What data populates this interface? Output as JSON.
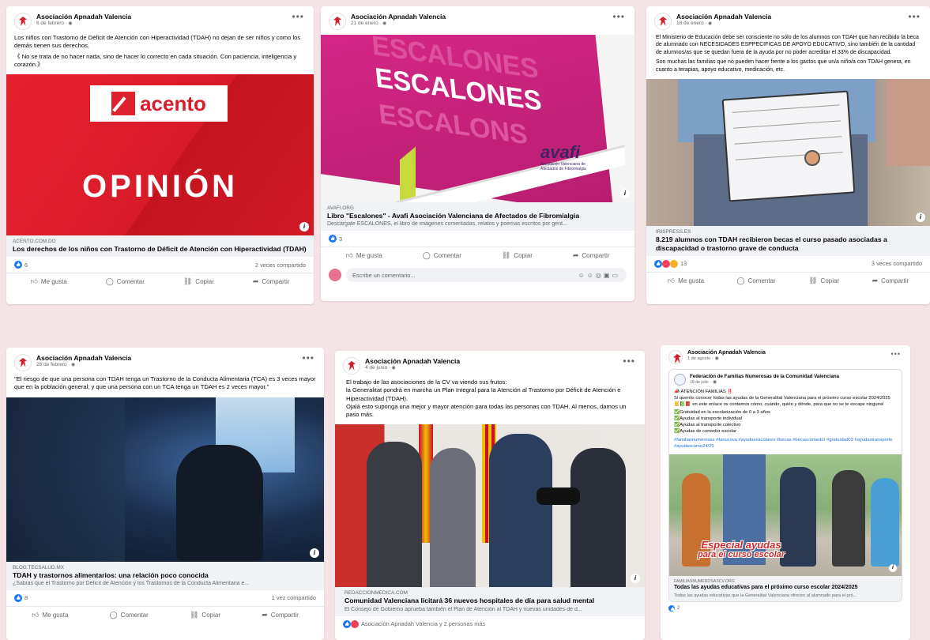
{
  "page_name": "Asociación Apnadah Valencia",
  "labels": {
    "like": "Me gusta",
    "comment": "Comentar",
    "copy": "Copiar",
    "share": "Compartir",
    "comment_placeholder": "Escribe un comentario..."
  },
  "posts": [
    {
      "date": "6 de febrero",
      "text": [
        "Los niños con Trastorno de Déficit de Atención con Hiperactividad (TDAH) no dejan de ser niños y como los demás tienen sus derechos.",
        "《 No se trata de no hacer nada, sino de hacer lo correcto en cada situación. Con paciencia, inteligencia y corazón.》"
      ],
      "image": {
        "brand": "acento",
        "caption": "OPINIÓN"
      },
      "link": {
        "source": "ACENTO.COM.DO",
        "title": "Los derechos de los niños con Trastorno de Déficit de Atención con Hiperactividad (TDAH)"
      },
      "reactions": "6",
      "shares": "2 veces compartido"
    },
    {
      "date": "21 de enero",
      "text": [],
      "image": {
        "book_words": [
          "ESCALONES",
          "ESCALONES",
          "ESCALONS"
        ],
        "brand": "avafi",
        "brand_sub": "Asociación Valenciana de Afectados de Fibromialgia"
      },
      "link": {
        "source": "AVAFI.ORG",
        "title": "Libro \"Escalones\" - Avafi Asociación Valenciana de Afectados de Fibromialgia",
        "desc": "Descárgate ESCALONES, el libro de imágenes comentadas, relatos y poemas escritos por gent..."
      },
      "reactions": "3",
      "shares": ""
    },
    {
      "date": "18 de enero",
      "text": [
        "El Ministerio de Educación debe ser consciente no sólo de los alumnos con TDAH que han recibido la beca de alumnado con NECESIDADES ESPPECIFICAS DE APOYO EDUCATIVO, sino también de la cantidad de alumnos/as que se quedan fuera de la ayuda por no poder acreditar el 33% de discapacidad.",
        "Son muchas las familias que no pueden hacer frente a los gastos que un/a niño/a con TDAH genera, en cuanto a terapias, apoyo educativo, medicación, etc."
      ],
      "link": {
        "source": "IRISPRESS.ES",
        "title": "8.219 alumnos con TDAH recibieron becas el curso pasado asociadas a discapacidad o trastorno grave de conducta"
      },
      "reactions": "13",
      "shares": "3 veces compartido"
    },
    {
      "date": "28 de febrero",
      "text": [
        "\"El riesgo de que una persona con TDAH tenga un Trastorno de la Conducta Alimentaria (TCA) es 3 veces mayor que en la población general; y que una persona con un TCA tenga un TDAH es 2 veces mayor.\""
      ],
      "link": {
        "source": "BLOG.TECSALUD.MX",
        "title": "TDAH y trastornos alimentarios: una relación poco conocida",
        "desc": "¿Sabías que el Trastorno por Déficit de Atención y los Trastornos de la Conducta Alimentaria e..."
      },
      "reactions": "8",
      "shares": "1 vez compartido"
    },
    {
      "date": "4 de junio",
      "text": [
        "El trabajo de las asociaciones de la CV va viendo sus frutos:",
        "la Generalitat pondrá en marcha un Plan Integral para la Atención al Trastorno por Déficit de Atención e Hiperactividad (TDAH).",
        "Ojalá esto suponga una mejor y mayor atención para todas las personas con TDAH. Al menos, damos un paso más."
      ],
      "link": {
        "source": "REDACCIONMEDICA.COM",
        "title": "Comunidad Valenciana licitará 36 nuevos hospitales de día para salud mental",
        "desc": "El Consejo de Gobierno aprueba también el Plan de Atención al TDAH y nuevas unidades de d..."
      },
      "reactions": "Asociación Apnadah Valencia y 2 personas más",
      "shares": ""
    },
    {
      "date": "1 de agosto",
      "shared": {
        "name": "Federación de Familias Numerosas de la Comunidad Valenciana",
        "date": "18 de julio",
        "lines": [
          "📣 ATENCIÓN FAMILIAS ‼️",
          "Si queréis conocer todas las ayudas de la Generalitat Valenciana para el próximo curso escolar 2024/2025 📒📗📕 en este enlace os contamos cómo, cuándo, quién y dónde, para que no se te escape ninguna!",
          "✅Gratuidad en la escolarización de 0 a 3 años",
          "✅Ayudas al transporte individual",
          "✅Ayudas al transporte colectivo",
          "✅Ayudas de comedor escolar"
        ],
        "tags": "#familiasnumerosas #fanucova #ayudasescolares #becas #becascomedor #gratuidad03 #ayudastransporte #ayudascurso24/25",
        "banner": [
          "Especial ayudas",
          "para el curso escolar"
        ]
      },
      "link": {
        "source": "FAMILIASNUMEROSASCV.ORG",
        "title": "Todas las ayudas educativas para el próximo curso escolar 2024/2025",
        "desc": "Todas las ayudas educativas que la Generalitat Valenciana ofrecen al alumnado para el pró..."
      },
      "reactions": "2",
      "shares": ""
    }
  ]
}
